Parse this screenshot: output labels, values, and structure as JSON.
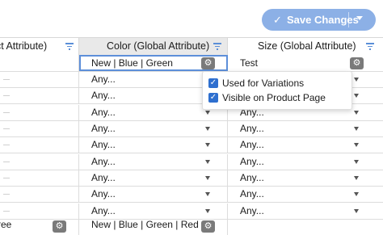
{
  "toolbar": {
    "save_label": "Save Changes",
    "check_glyph": "✓",
    "accent": "#8cb0e6"
  },
  "columns": [
    {
      "label": "uct Attribute)"
    },
    {
      "label": "Color (Global Attribute)"
    },
    {
      "label": "Size (Global Attribute)"
    }
  ],
  "edit_row": {
    "color_value": "New | Blue | Green",
    "size_value": "Test"
  },
  "rows": [
    {
      "color": "Any...",
      "size": "Any..."
    },
    {
      "color": "Any...",
      "size": "Any..."
    },
    {
      "color": "Any...",
      "size": "Any..."
    },
    {
      "color": "Any...",
      "size": "Any..."
    },
    {
      "color": "Any...",
      "size": "Any..."
    },
    {
      "color": "Any...",
      "size": "Any..."
    },
    {
      "color": "Any...",
      "size": "Any..."
    },
    {
      "color": "Any...",
      "size": "Any..."
    },
    {
      "color": "Any...",
      "size": "Any..."
    }
  ],
  "last_row": {
    "left_value": "ree",
    "color_value": "New | Blue | Green | Red"
  },
  "popover": {
    "options": [
      {
        "label": "Used for Variations",
        "checked": true
      },
      {
        "label": "Visible on Product Page",
        "checked": true
      }
    ]
  },
  "icons": {
    "gear": "⚙"
  }
}
